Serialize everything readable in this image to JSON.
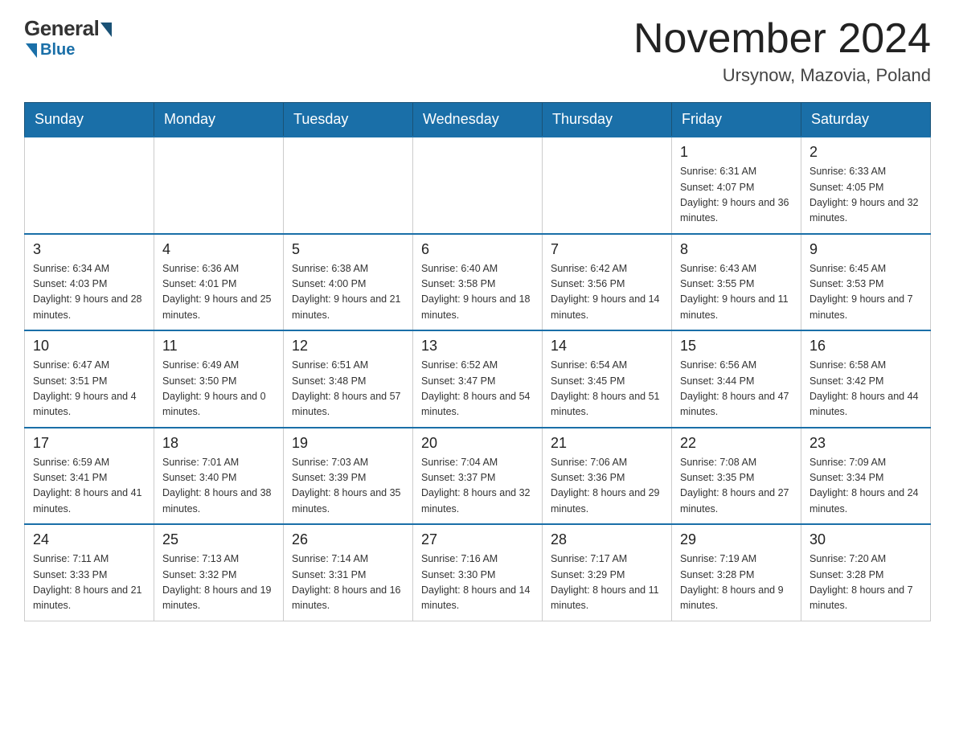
{
  "header": {
    "logo": {
      "general": "General",
      "blue": "Blue"
    },
    "title": "November 2024",
    "location": "Ursynow, Mazovia, Poland"
  },
  "calendar": {
    "days_of_week": [
      "Sunday",
      "Monday",
      "Tuesday",
      "Wednesday",
      "Thursday",
      "Friday",
      "Saturday"
    ],
    "weeks": [
      {
        "days": [
          {
            "number": "",
            "info": "",
            "empty": true
          },
          {
            "number": "",
            "info": "",
            "empty": true
          },
          {
            "number": "",
            "info": "",
            "empty": true
          },
          {
            "number": "",
            "info": "",
            "empty": true
          },
          {
            "number": "",
            "info": "",
            "empty": true
          },
          {
            "number": "1",
            "info": "Sunrise: 6:31 AM\nSunset: 4:07 PM\nDaylight: 9 hours and 36 minutes."
          },
          {
            "number": "2",
            "info": "Sunrise: 6:33 AM\nSunset: 4:05 PM\nDaylight: 9 hours and 32 minutes."
          }
        ]
      },
      {
        "days": [
          {
            "number": "3",
            "info": "Sunrise: 6:34 AM\nSunset: 4:03 PM\nDaylight: 9 hours and 28 minutes."
          },
          {
            "number": "4",
            "info": "Sunrise: 6:36 AM\nSunset: 4:01 PM\nDaylight: 9 hours and 25 minutes."
          },
          {
            "number": "5",
            "info": "Sunrise: 6:38 AM\nSunset: 4:00 PM\nDaylight: 9 hours and 21 minutes."
          },
          {
            "number": "6",
            "info": "Sunrise: 6:40 AM\nSunset: 3:58 PM\nDaylight: 9 hours and 18 minutes."
          },
          {
            "number": "7",
            "info": "Sunrise: 6:42 AM\nSunset: 3:56 PM\nDaylight: 9 hours and 14 minutes."
          },
          {
            "number": "8",
            "info": "Sunrise: 6:43 AM\nSunset: 3:55 PM\nDaylight: 9 hours and 11 minutes."
          },
          {
            "number": "9",
            "info": "Sunrise: 6:45 AM\nSunset: 3:53 PM\nDaylight: 9 hours and 7 minutes."
          }
        ]
      },
      {
        "days": [
          {
            "number": "10",
            "info": "Sunrise: 6:47 AM\nSunset: 3:51 PM\nDaylight: 9 hours and 4 minutes."
          },
          {
            "number": "11",
            "info": "Sunrise: 6:49 AM\nSunset: 3:50 PM\nDaylight: 9 hours and 0 minutes."
          },
          {
            "number": "12",
            "info": "Sunrise: 6:51 AM\nSunset: 3:48 PM\nDaylight: 8 hours and 57 minutes."
          },
          {
            "number": "13",
            "info": "Sunrise: 6:52 AM\nSunset: 3:47 PM\nDaylight: 8 hours and 54 minutes."
          },
          {
            "number": "14",
            "info": "Sunrise: 6:54 AM\nSunset: 3:45 PM\nDaylight: 8 hours and 51 minutes."
          },
          {
            "number": "15",
            "info": "Sunrise: 6:56 AM\nSunset: 3:44 PM\nDaylight: 8 hours and 47 minutes."
          },
          {
            "number": "16",
            "info": "Sunrise: 6:58 AM\nSunset: 3:42 PM\nDaylight: 8 hours and 44 minutes."
          }
        ]
      },
      {
        "days": [
          {
            "number": "17",
            "info": "Sunrise: 6:59 AM\nSunset: 3:41 PM\nDaylight: 8 hours and 41 minutes."
          },
          {
            "number": "18",
            "info": "Sunrise: 7:01 AM\nSunset: 3:40 PM\nDaylight: 8 hours and 38 minutes."
          },
          {
            "number": "19",
            "info": "Sunrise: 7:03 AM\nSunset: 3:39 PM\nDaylight: 8 hours and 35 minutes."
          },
          {
            "number": "20",
            "info": "Sunrise: 7:04 AM\nSunset: 3:37 PM\nDaylight: 8 hours and 32 minutes."
          },
          {
            "number": "21",
            "info": "Sunrise: 7:06 AM\nSunset: 3:36 PM\nDaylight: 8 hours and 29 minutes."
          },
          {
            "number": "22",
            "info": "Sunrise: 7:08 AM\nSunset: 3:35 PM\nDaylight: 8 hours and 27 minutes."
          },
          {
            "number": "23",
            "info": "Sunrise: 7:09 AM\nSunset: 3:34 PM\nDaylight: 8 hours and 24 minutes."
          }
        ]
      },
      {
        "days": [
          {
            "number": "24",
            "info": "Sunrise: 7:11 AM\nSunset: 3:33 PM\nDaylight: 8 hours and 21 minutes."
          },
          {
            "number": "25",
            "info": "Sunrise: 7:13 AM\nSunset: 3:32 PM\nDaylight: 8 hours and 19 minutes."
          },
          {
            "number": "26",
            "info": "Sunrise: 7:14 AM\nSunset: 3:31 PM\nDaylight: 8 hours and 16 minutes."
          },
          {
            "number": "27",
            "info": "Sunrise: 7:16 AM\nSunset: 3:30 PM\nDaylight: 8 hours and 14 minutes."
          },
          {
            "number": "28",
            "info": "Sunrise: 7:17 AM\nSunset: 3:29 PM\nDaylight: 8 hours and 11 minutes."
          },
          {
            "number": "29",
            "info": "Sunrise: 7:19 AM\nSunset: 3:28 PM\nDaylight: 8 hours and 9 minutes."
          },
          {
            "number": "30",
            "info": "Sunrise: 7:20 AM\nSunset: 3:28 PM\nDaylight: 8 hours and 7 minutes."
          }
        ]
      }
    ]
  }
}
